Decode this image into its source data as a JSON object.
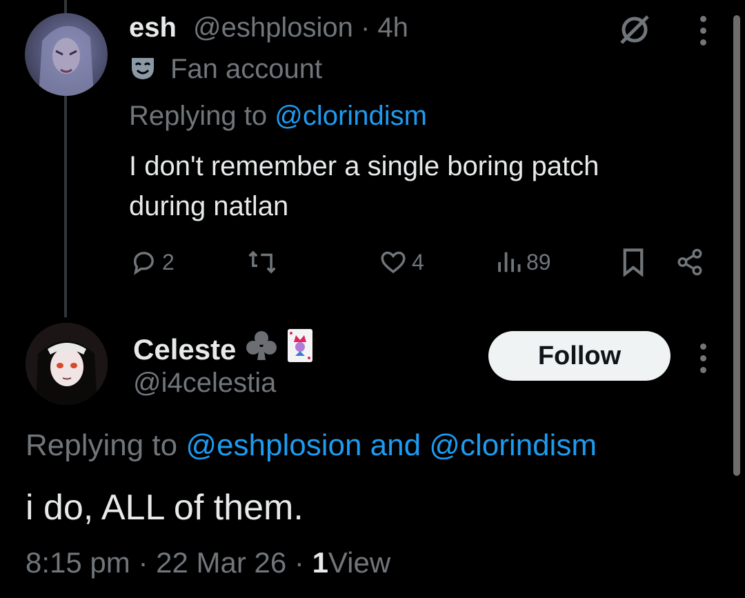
{
  "tweet1": {
    "display_name": "esh",
    "meta": "@eshplosion · 4h",
    "label_icon": "theater-mask-icon",
    "label": "Fan account",
    "replying_prefix": "Replying to",
    "replying_to": "@clorindism",
    "text_line1": "I don't remember a single boring patch",
    "text_line2": "during natlan",
    "replies": "2",
    "likes": "4",
    "views": "89"
  },
  "tweet2": {
    "display_name": "Celeste",
    "name_emoji_1": "club-suit-icon",
    "name_emoji_2": "joker-card-icon",
    "handle": "@i4celestia",
    "follow_label": "Follow",
    "replying_prefix": "Replying to",
    "replying_to": "@eshplosion and @clorindism",
    "text": "i do, ALL of them.",
    "time": "8:15 pm",
    "separator": "·",
    "date": "22 Mar 26",
    "view_count": "1",
    "view_label": "View"
  },
  "colors": {
    "background": "#000000",
    "text": "#e7e9ea",
    "muted": "#71767b",
    "link": "#1d9bf0",
    "button_bg": "#eff3f4"
  }
}
